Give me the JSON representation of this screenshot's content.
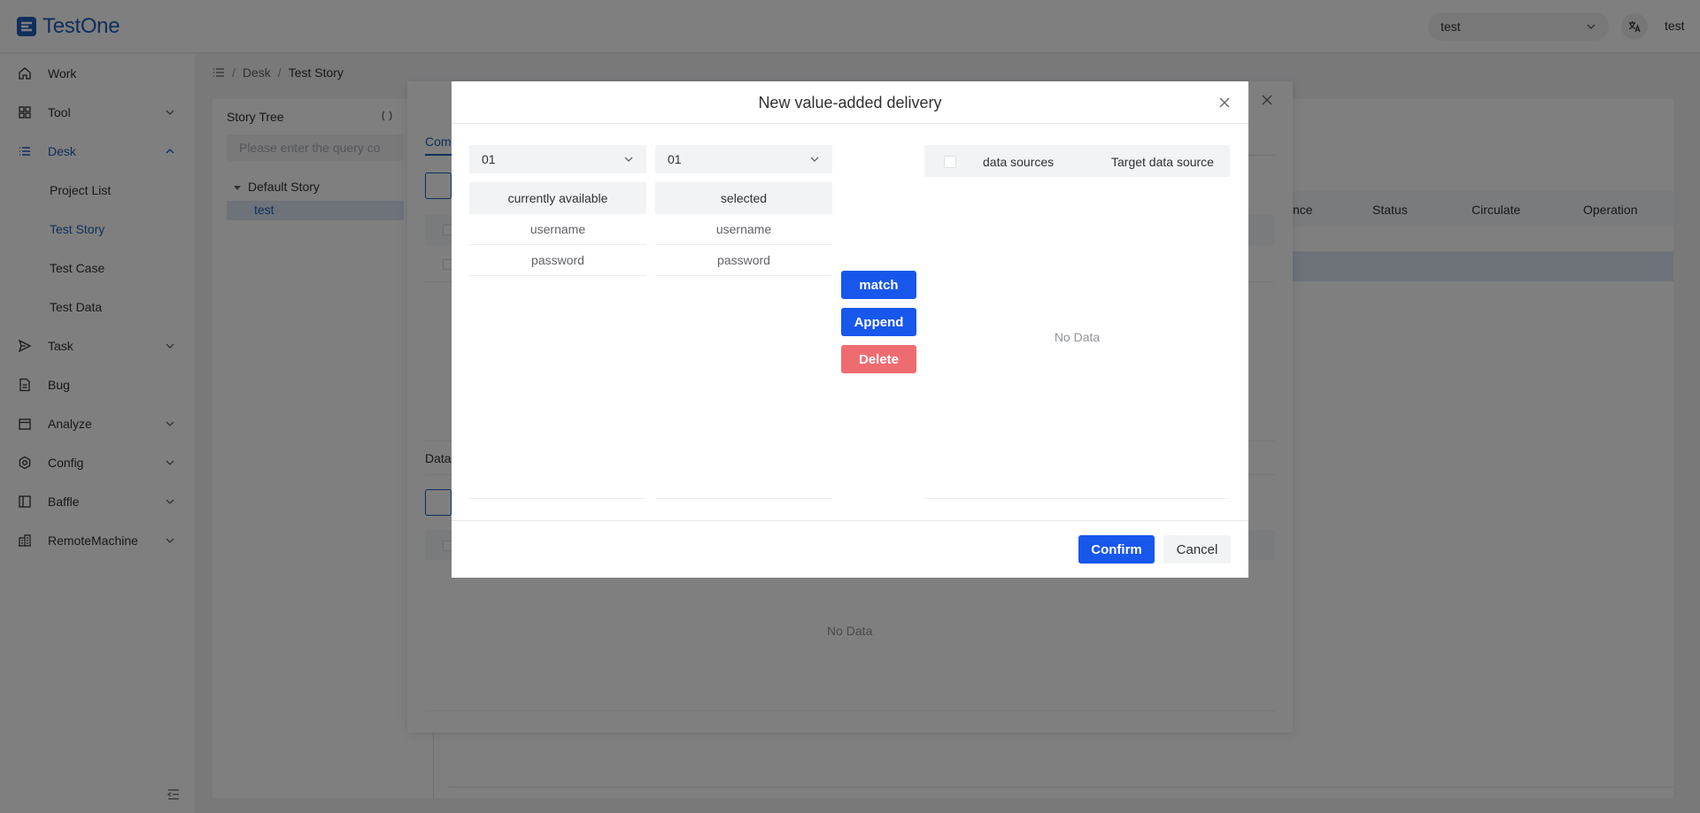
{
  "app": {
    "logo_text": "TestOne",
    "project_select_value": "test",
    "user_name": "test"
  },
  "sidebar": {
    "items": [
      {
        "label": "Work",
        "icon": "home-icon"
      },
      {
        "label": "Tool",
        "icon": "grid-icon"
      },
      {
        "label": "Desk",
        "icon": "list-icon"
      },
      {
        "label": "Task",
        "icon": "send-icon"
      },
      {
        "label": "Bug",
        "icon": "document-icon"
      },
      {
        "label": "Analyze",
        "icon": "calendar-icon"
      },
      {
        "label": "Config",
        "icon": "gear-icon"
      },
      {
        "label": "Baffle",
        "icon": "panel-icon"
      },
      {
        "label": "RemoteMachine",
        "icon": "building-icon"
      }
    ],
    "desk_sub_items": [
      "Project List",
      "Test Story",
      "Test Case",
      "Test Data"
    ]
  },
  "breadcrumb": {
    "items": [
      "Desk",
      "Test Story"
    ]
  },
  "story_tree": {
    "title": "Story Tree",
    "search_placeholder": "Please enter the query co",
    "nodes": [
      "Default Story",
      "test"
    ]
  },
  "story_table": {
    "columns": [
      "nce",
      "Status",
      "Circulate",
      "Operation"
    ]
  },
  "background_dialog": {
    "tab_label": "Com",
    "section_label": "Data",
    "no_data": "No Data"
  },
  "modal": {
    "title": "New value-added delivery",
    "left_select_value": "01",
    "right_select_value": "01",
    "available_header": "currently available",
    "selected_header": "selected",
    "available_rows": [
      "username",
      "password"
    ],
    "selected_rows": [
      "username",
      "password"
    ],
    "buttons": {
      "match": "match",
      "append": "Append",
      "delete": "Delete"
    },
    "mapping_table": {
      "col_source": "data sources",
      "col_target": "Target data source",
      "no_data": "No Data"
    },
    "confirm": "Confirm",
    "cancel": "Cancel"
  },
  "colors": {
    "brand": "#1f5fb8",
    "primary_button": "#1857ec",
    "danger_button": "#ee6c70"
  }
}
